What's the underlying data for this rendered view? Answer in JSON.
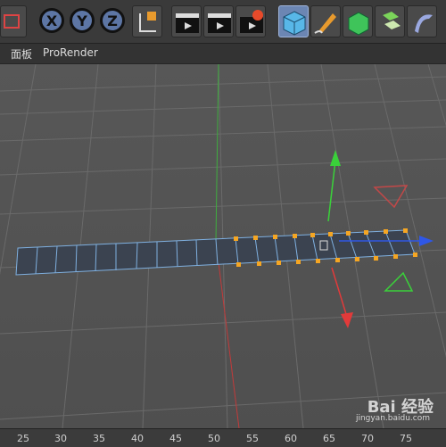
{
  "toolbar": {
    "axis_x": "X",
    "axis_y": "Y",
    "axis_z": "Z"
  },
  "menubar": {
    "items": [
      "面板",
      "ProRender"
    ]
  },
  "viewport": {
    "ruler_labels": [
      "25",
      "30",
      "35",
      "40",
      "45",
      "50",
      "55",
      "60",
      "65",
      "70",
      "75"
    ]
  },
  "watermark": {
    "main": "Bai 经验",
    "sub": "jingyan.baidu.com"
  },
  "colors": {
    "selection": "#f5a623",
    "axis_x": "#e23a3a",
    "axis_y": "#3ad13a",
    "axis_z": "#2f57e6",
    "polygon": "#3b4350",
    "grid": "#6a6a6a"
  }
}
